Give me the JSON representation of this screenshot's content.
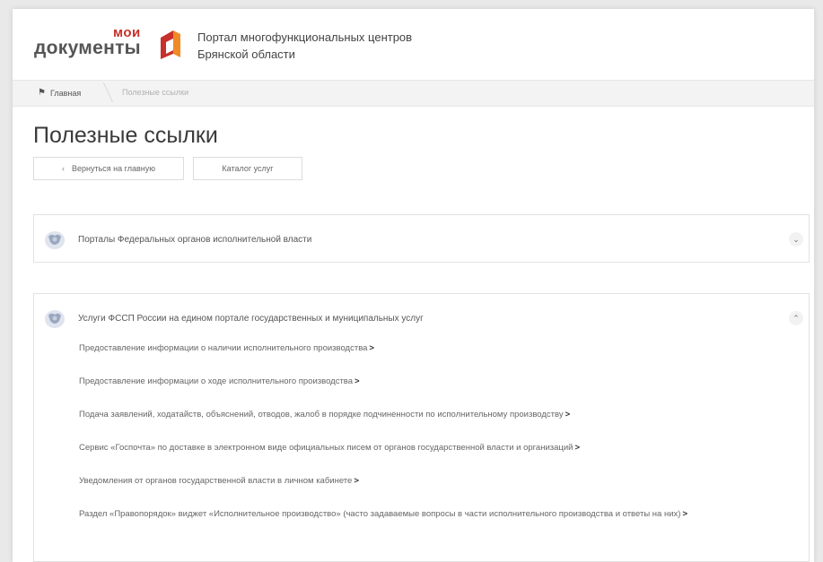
{
  "header": {
    "logo_top": "мои",
    "logo_bottom": "документы",
    "portal_title_line1": "Портал многофункциональных центров",
    "portal_title_line2": "Брянской области",
    "brand_red": "#c8312b",
    "brand_orange": "#f08a24"
  },
  "breadcrumb": {
    "home_icon": "home-icon",
    "home": "Главная",
    "current": "Полезные ссылки"
  },
  "page": {
    "title": "Полезные ссылки",
    "back_button": "Вернуться на главную",
    "catalog_button": "Каталог услуг"
  },
  "panels": [
    {
      "icon": "emblem-icon",
      "title": "Порталы Федеральных органов исполнительной власти",
      "state": "collapsed",
      "toggle_icon": "chevron-down-icon"
    },
    {
      "icon": "emblem-icon",
      "title": "Услуги ФССП России на едином портале государственных и муниципальных услуг",
      "state": "expanded",
      "toggle_icon": "chevron-up-icon",
      "links": [
        "Предоставление информации о наличии исполнительного производства",
        "Предоставление информации о ходе исполнительного производства",
        "Подача заявлений, ходатайств, объяснений, отводов, жалоб в порядке подчиненности по исполнительному производству",
        "Сервис «Госпочта» по доставке в электронном виде официальных писем от органов государственной власти и организаций",
        "Уведомления от органов государственной власти в личном кабинете",
        "Раздел «Правопорядок» виджет «Исполнительное производство» (часто задаваемые вопросы в части исполнительного производства и ответы на них)"
      ]
    }
  ]
}
